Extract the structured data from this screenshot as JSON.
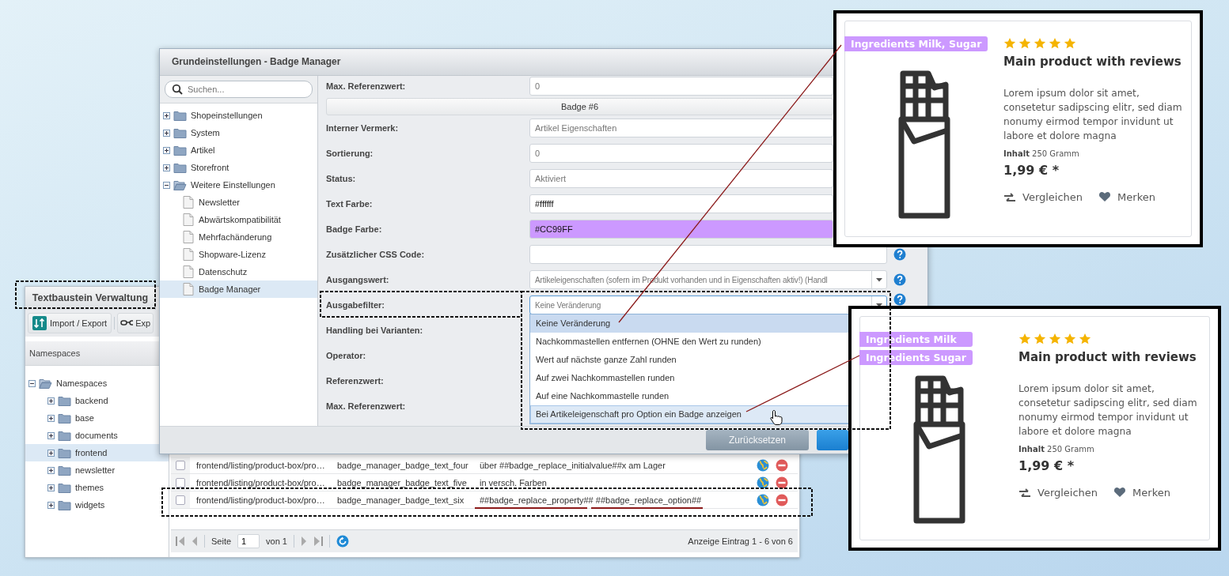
{
  "textbaustein_window": {
    "title": "Textbaustein Verwaltung",
    "toolbar": [
      {
        "label": "Import / Export",
        "kind": "import"
      },
      {
        "label": "Exp",
        "kind": "glasses"
      }
    ],
    "namespaces_panel": {
      "title": "Namespaces",
      "tree": [
        {
          "label": "Namespaces",
          "kind": "folder",
          "expanded": true,
          "selected": false,
          "children": [
            {
              "label": "backend",
              "kind": "folder",
              "expanded": false,
              "selected": false
            },
            {
              "label": "base",
              "kind": "folder",
              "expanded": false,
              "selected": false
            },
            {
              "label": "documents",
              "kind": "folder",
              "expanded": false,
              "selected": false
            },
            {
              "label": "frontend",
              "kind": "folder",
              "expanded": false,
              "selected": true
            },
            {
              "label": "newsletter",
              "kind": "folder",
              "expanded": false,
              "selected": false
            },
            {
              "label": "themes",
              "kind": "folder",
              "expanded": false,
              "selected": false
            },
            {
              "label": "widgets",
              "kind": "folder",
              "expanded": false,
              "selected": false
            }
          ]
        }
      ]
    },
    "grid": {
      "rows": [
        {
          "checked": false,
          "namespace": "frontend/listing/product-box/pro…",
          "name": "badge_manager_badge_text_four",
          "value": "über ##badge_replace_initialvalue##x am Lager"
        },
        {
          "checked": false,
          "namespace": "frontend/listing/product-box/pro…",
          "name": "badge_manager_badge_text_five",
          "value": "in versch. Farben"
        },
        {
          "checked": false,
          "namespace": "frontend/listing/product-box/pro…",
          "name": "badge_manager_badge_text_six",
          "value": "##badge_replace_property## ##badge_replace_option##"
        }
      ]
    },
    "paging": {
      "page_label": "Seite",
      "page": "1",
      "of": "von 1",
      "summary": "Anzeige Eintrag 1 - 6 von 6"
    }
  },
  "settings_dialog": {
    "title": "Grundeinstellungen - Badge Manager",
    "search": {
      "placeholder": "Suchen..."
    },
    "tree": [
      {
        "label": "Shopeinstellungen",
        "kind": "folder",
        "expanded": false,
        "selected": false
      },
      {
        "label": "System",
        "kind": "folder",
        "expanded": false,
        "selected": false
      },
      {
        "label": "Artikel",
        "kind": "folder",
        "expanded": false,
        "selected": false
      },
      {
        "label": "Storefront",
        "kind": "folder",
        "expanded": false,
        "selected": false
      },
      {
        "label": "Weitere Einstellungen",
        "kind": "folder",
        "expanded": true,
        "selected": false,
        "children": [
          {
            "label": "Newsletter",
            "kind": "leaf",
            "selected": false
          },
          {
            "label": "Abwärtskompatibilität",
            "kind": "leaf",
            "selected": false
          },
          {
            "label": "Mehrfachänderung",
            "kind": "leaf",
            "selected": false
          },
          {
            "label": "Shopware-Lizenz",
            "kind": "leaf",
            "selected": false
          },
          {
            "label": "Datenschutz",
            "kind": "leaf",
            "selected": false
          },
          {
            "label": "Badge Manager",
            "kind": "leaf",
            "selected": true
          }
        ]
      }
    ],
    "fields": [
      {
        "label": "Max. Referenzwert:",
        "kind": "text",
        "value": "0"
      },
      {
        "label": "Badge #6",
        "kind": "section"
      },
      {
        "label": "Interner Vermerk:",
        "kind": "text",
        "value": "Artikel Eigenschaften"
      },
      {
        "label": "Sortierung:",
        "kind": "text",
        "value": "0"
      },
      {
        "label": "Status:",
        "kind": "text",
        "value": "Aktiviert"
      },
      {
        "label": "Text Farbe:",
        "kind": "color",
        "value": "#ffffff",
        "color": "#ffffff"
      },
      {
        "label": "Badge Farbe:",
        "kind": "color",
        "value": "#CC99FF",
        "color": "#cc99ff"
      },
      {
        "label": "Zusätzlicher CSS Code:",
        "kind": "text",
        "help": true
      },
      {
        "label": "Ausgangswert:",
        "kind": "combo",
        "value": "Artikeleigenschaften (sofern im Produkt vorhanden und in Eigenschaften aktiv!) (Handl",
        "focused": false,
        "help": true
      },
      {
        "label": "Ausgabefilter:",
        "kind": "combo",
        "value": "Keine Veränderung",
        "focused": true,
        "help": true
      },
      {
        "label": "Handling bei Varianten:",
        "kind": "label"
      },
      {
        "label": "Operator:",
        "kind": "label"
      },
      {
        "label": "Referenzwert:",
        "kind": "label"
      },
      {
        "label": "Max. Referenzwert:",
        "kind": "label"
      }
    ],
    "dropdown": {
      "options": [
        {
          "label": "Keine Veränderung",
          "selected": true,
          "hovered": false
        },
        {
          "label": "Nachkommastellen entfernen (OHNE den Wert zu runden)",
          "selected": false,
          "hovered": false
        },
        {
          "label": "Wert auf nächste ganze Zahl runden",
          "selected": false,
          "hovered": false
        },
        {
          "label": "Auf zwei Nachkommastellen runden",
          "selected": false,
          "hovered": false
        },
        {
          "label": "Auf eine Nachkommastelle runden",
          "selected": false,
          "hovered": false
        },
        {
          "label": "Bei Artikeleigenschaft pro Option ein Badge anzeigen",
          "selected": false,
          "hovered": true
        }
      ]
    },
    "buttons": [
      {
        "label": "Zurücksetzen",
        "kind": "secondary"
      },
      {
        "kind": "primary"
      }
    ]
  },
  "product_cards": [
    {
      "badges": [
        {
          "label": "Ingredients Milk, Sugar",
          "color": "#cc99ff"
        }
      ],
      "stars": 5,
      "title": "Main product with reviews",
      "description": "Lorem ipsum dolor sit amet, consetetur sadipscing elitr, sed diam nonumy eirmod tempor invidunt ut labore et dolore magna",
      "content": "**Inhalt** 250 Gramm",
      "price": "1,99 € *",
      "actions": [
        {
          "label": "Vergleichen",
          "kind": "compare"
        },
        {
          "label": "Merken",
          "kind": "wishlist"
        }
      ]
    },
    {
      "badges": [
        {
          "label": "Ingredients Milk",
          "color": "#cc99ff"
        },
        {
          "label": "Ingredients Sugar",
          "color": "#cc99ff"
        }
      ],
      "stars": 5,
      "title": "Main product with reviews",
      "description": "Lorem ipsum dolor sit amet, consetetur sadipscing elitr, sed diam nonumy eirmod tempor invidunt ut labore et dolore magna",
      "content": "**Inhalt** 250 Gramm",
      "price": "1,99 € *",
      "actions": [
        {
          "label": "Vergleichen",
          "kind": "compare"
        },
        {
          "label": "Merken",
          "kind": "wishlist"
        }
      ]
    }
  ]
}
